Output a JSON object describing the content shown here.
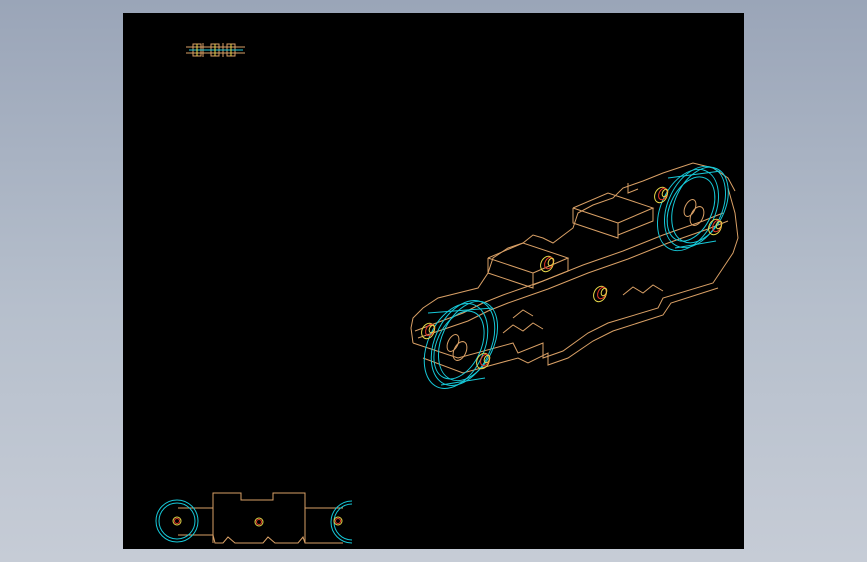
{
  "drawing": {
    "background": "#000000",
    "app_background": "#a9b2c2",
    "colors": {
      "outline": "#d9a066",
      "wheel": "#16c8d8",
      "pin_outer": "#e8d84a",
      "pin_inner": "#e83a2a"
    },
    "views": [
      "top-view",
      "isometric-view",
      "front-view"
    ]
  }
}
